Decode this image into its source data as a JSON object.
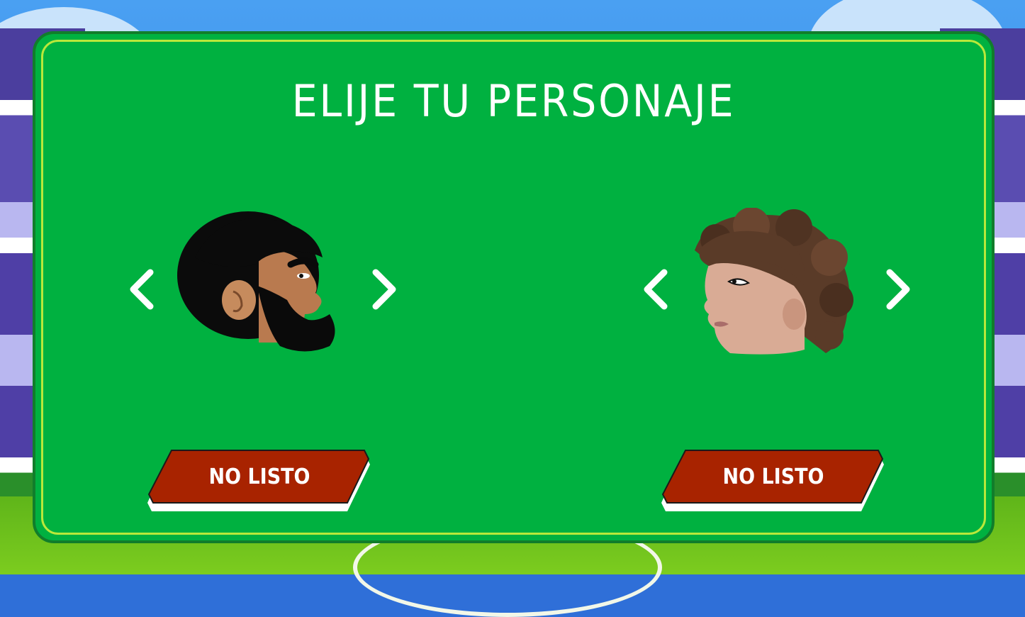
{
  "screen": {
    "title": "ELIJE TU PERSONAJE"
  },
  "players": [
    {
      "character": "bearded-man-head",
      "prev_icon": "chevron-left-icon",
      "next_icon": "chevron-right-icon",
      "ready_label": "NO LISTO"
    },
    {
      "character": "curly-hair-head",
      "prev_icon": "chevron-left-icon",
      "next_icon": "chevron-right-icon",
      "ready_label": "NO LISTO"
    }
  ],
  "colors": {
    "panel": "#00b140",
    "panel_border": "#117d2b",
    "panel_inner_line": "#b9e83a",
    "button_red": "#a82300",
    "text": "#ffffff"
  }
}
